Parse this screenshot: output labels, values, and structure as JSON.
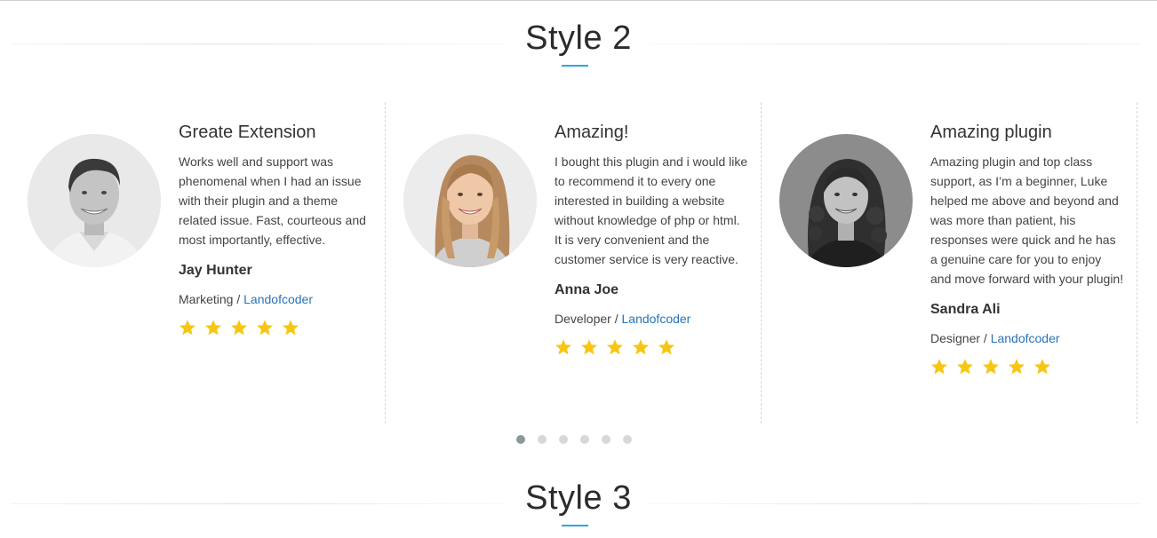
{
  "sections": {
    "style2_title": "Style 2",
    "style3_title": "Style 3"
  },
  "colors": {
    "accent": "#29a9d9",
    "link": "#2a73b8",
    "star": "#f7c613",
    "dot_active": "#8a9a9a",
    "dot_inactive": "#d8d8d8"
  },
  "testimonials": [
    {
      "title": "Greate Extension",
      "body": "Works well and support was phenomenal when I had an issue with their plugin and a theme related issue. Fast, courteous and most importantly, effective.",
      "name": "Jay Hunter",
      "role": "Marketing",
      "separator": " / ",
      "company": "Landofcoder",
      "rating": 5,
      "photo_icon": "man-portrait-photo"
    },
    {
      "title": "Amazing!",
      "body": "I bought this plugin and i would like to recommend it to every one interested in building a website without knowledge of php or html. It is very convenient and the customer service is very reactive.",
      "name": "Anna Joe",
      "role": "Developer",
      "separator": " / ",
      "company": "Landofcoder",
      "rating": 5,
      "photo_icon": "woman-blonde-portrait-photo"
    },
    {
      "title": "Amazing plugin",
      "body": "Amazing plugin and top class support, as I’m a beginner, Luke helped me above and beyond and was more than patient, his responses were quick and he has a genuine care for you to enjoy and move forward with your plugin!",
      "name": "Sandra Ali",
      "role": "Designer",
      "separator": " / ",
      "company": "Landofcoder",
      "rating": 5,
      "photo_icon": "woman-curly-portrait-photo"
    }
  ],
  "pagination": {
    "pages": 6,
    "active_index": 0
  }
}
